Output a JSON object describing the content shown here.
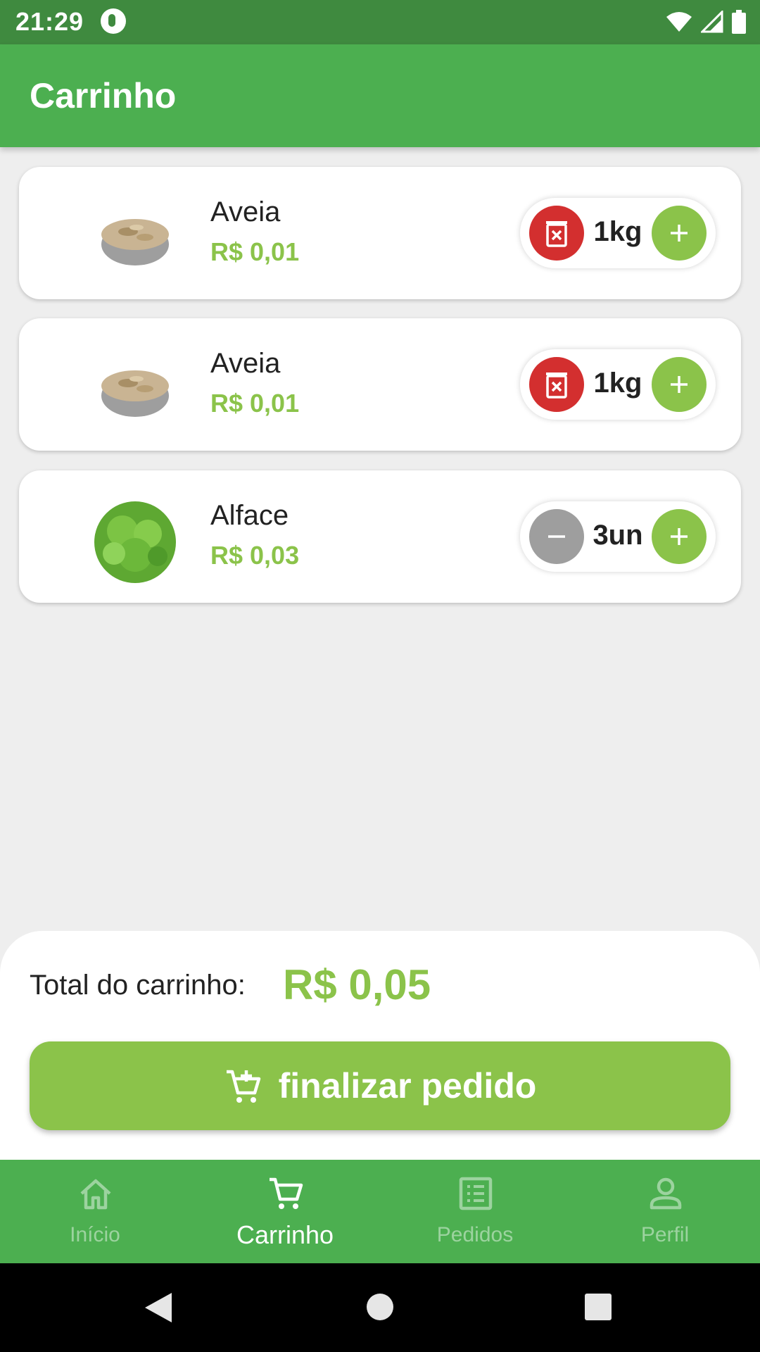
{
  "status_bar": {
    "time": "21:29"
  },
  "app_bar": {
    "title": "Carrinho"
  },
  "cart_items": [
    {
      "name": "Aveia",
      "price": "R$ 0,01",
      "quantity": "1kg",
      "decrease_action": "delete"
    },
    {
      "name": "Aveia",
      "price": "R$ 0,01",
      "quantity": "1kg",
      "decrease_action": "delete"
    },
    {
      "name": "Alface",
      "price": "R$ 0,03",
      "quantity": "3un",
      "decrease_action": "minus"
    }
  ],
  "summary": {
    "total_label": "Total do carrinho:",
    "total_value": "R$ 0,05",
    "checkout_label": "finalizar pedido"
  },
  "bottom_nav": {
    "items": [
      {
        "label": "Início",
        "icon": "home-icon",
        "active": false
      },
      {
        "label": "Carrinho",
        "icon": "cart-icon",
        "active": true
      },
      {
        "label": "Pedidos",
        "icon": "orders-icon",
        "active": false
      },
      {
        "label": "Perfil",
        "icon": "profile-icon",
        "active": false
      }
    ]
  },
  "colors": {
    "primary_green": "#4caf50",
    "status_green": "#3f8a3f",
    "accent_green": "#8bc34a",
    "delete_red": "#d32f2f",
    "disabled_grey": "#9e9e9e"
  }
}
